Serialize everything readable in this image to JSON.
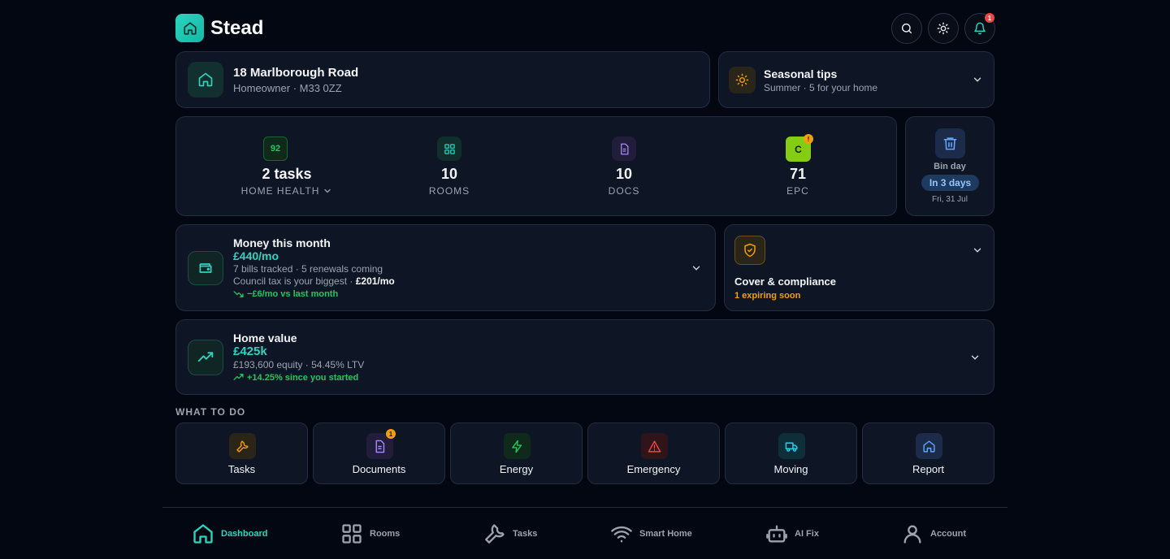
{
  "app": {
    "name": "Stead",
    "notification_count": "1"
  },
  "property": {
    "address": "18 Marlborough Road",
    "subtitle": "Homeowner · M33 0ZZ"
  },
  "seasonal": {
    "title": "Seasonal tips",
    "subtitle": "Summer · 5 for your home"
  },
  "stats": [
    {
      "badge": "92",
      "value": "2 tasks",
      "label": "HOME HEALTH"
    },
    {
      "value": "10",
      "label": "ROOMS"
    },
    {
      "value": "10",
      "label": "DOCS"
    },
    {
      "badge": "C",
      "alert": "!",
      "value": "71",
      "label": "EPC"
    }
  ],
  "bin": {
    "title": "Bin day",
    "pill": "In 3 days",
    "date": "Fri, 31 Jul"
  },
  "money": {
    "title": "Money this month",
    "amount": "£440/mo",
    "line1": "7 bills tracked · 5 renewals coming",
    "line2_prefix": "Council tax is your biggest · ",
    "line2_value": "£201/mo",
    "trend": "−£6/mo vs last month"
  },
  "cover": {
    "title": "Cover & compliance",
    "subtitle": "1 expiring soon"
  },
  "home_value": {
    "title": "Home value",
    "amount": "£425k",
    "line1": "£193,600 equity · 54.45% LTV",
    "trend": "+14.25% since you started"
  },
  "what_to_do": {
    "heading": "WHAT TO DO",
    "items": [
      {
        "label": "Tasks",
        "icon": "wrench-icon"
      },
      {
        "label": "Documents",
        "icon": "document-icon",
        "badge": "1"
      },
      {
        "label": "Energy",
        "icon": "bolt-icon"
      },
      {
        "label": "Emergency",
        "icon": "warning-icon"
      },
      {
        "label": "Moving",
        "icon": "truck-icon"
      },
      {
        "label": "Report",
        "icon": "house-icon"
      }
    ]
  },
  "nav": [
    {
      "label": "Dashboard",
      "active": true
    },
    {
      "label": "Rooms"
    },
    {
      "label": "Tasks"
    },
    {
      "label": "Smart Home"
    },
    {
      "label": "AI Fix"
    },
    {
      "label": "Account"
    }
  ],
  "colors": {
    "accent": "#2dd4bf",
    "green": "#22c55e",
    "amber": "#f59e0b",
    "epc": "#84cc16",
    "bg": "#030712",
    "card": "#0e1626"
  }
}
